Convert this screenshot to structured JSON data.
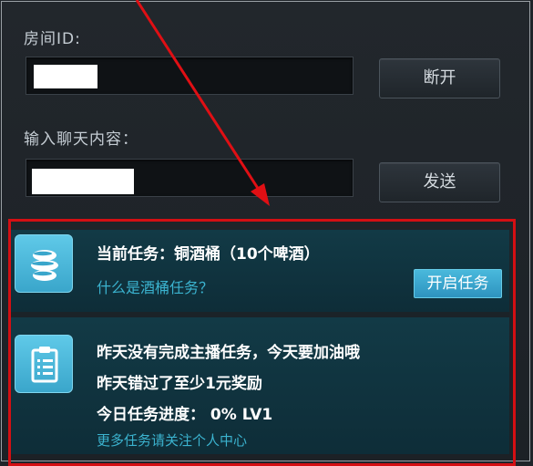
{
  "room": {
    "label": "房间ID:",
    "disconnect_label": "断开"
  },
  "chat": {
    "label": "输入聊天内容：",
    "send_label": "发送"
  },
  "task_current": {
    "title": "当前任务：铜酒桶（10个啤酒）",
    "help_link": "什么是酒桶任务？",
    "start_label": "开启任务",
    "icon": "barrel-icon"
  },
  "task_status": {
    "line1": "昨天没有完成主播任务，今天要加油哦",
    "line2": "昨天错过了至少1元奖励",
    "progress": "今日任务进度： 0% LV1",
    "more_link": "更多任务请关注个人中心",
    "icon": "clipboard-icon"
  },
  "colors": {
    "accent": "#3bb3cf",
    "highlight_border": "#d40f13",
    "background": "#1f2429"
  }
}
